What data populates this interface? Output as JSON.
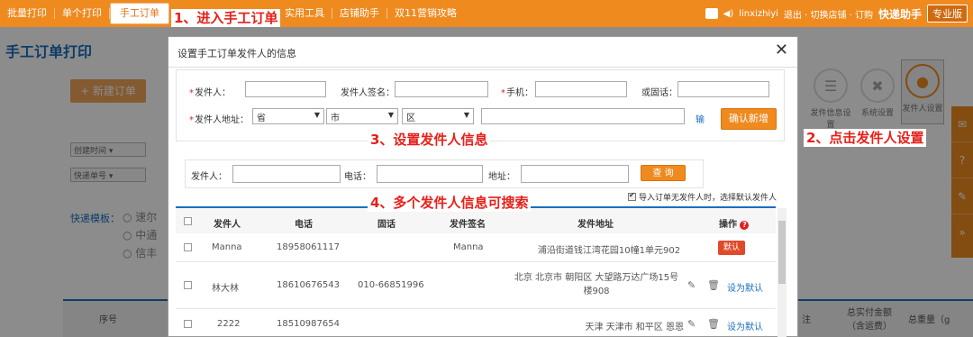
{
  "topbar": {
    "nav": [
      "批量打印",
      "单个打印",
      "手工订单",
      "实用工具",
      "店铺助手",
      "双11营销攻略"
    ],
    "active_index": 2,
    "user": "linxizhiyi",
    "links": "退出 · 切换店铺 · 订购",
    "brand": "快递助手",
    "edition": "专业版"
  },
  "page": {
    "title": "手工订单打印",
    "new_button": "+ 新建订单",
    "filter_created": "创建时间",
    "filter_express_no": "快递单号",
    "express_template_label": "快递模板：",
    "radio_options": [
      "速尔",
      "中通",
      "信丰"
    ],
    "bg_columns": [
      "序号",
      "注",
      "总实付金额（含运费）",
      "总重量（g"
    ],
    "tools": [
      "发件信息设置",
      "系统设置",
      "发件人设置"
    ]
  },
  "modal": {
    "title": "设置手工订单发件人的信息",
    "close": "✕",
    "form": {
      "sender_label": "发件人：",
      "sign_label": "发件人签名：",
      "mobile_label": "手机：",
      "phone_label": "或固话：",
      "address_label": "发件人地址：",
      "province": "省",
      "city": "市",
      "district": "区",
      "hint": "输",
      "confirm": "确认新增"
    },
    "search": {
      "sender_label": "发件人：",
      "phone_label": "电话：",
      "address_label": "地址：",
      "button": "查 询"
    },
    "default_checkbox": "导入订单无发件人时，选择默认发件人",
    "columns": [
      "发件人",
      "电话",
      "固话",
      "发件签名",
      "发件地址",
      "操作"
    ],
    "rows": [
      {
        "name": "Manna",
        "phone": "18958061117",
        "tel": "",
        "sign": "Manna",
        "address": "浦沿街道钱江湾花园10幢1单元902",
        "is_default": true,
        "action": "默认"
      },
      {
        "name": "林大林",
        "phone": "18610676543",
        "tel": "010-66851996",
        "sign": "",
        "address": "北京 北京市 朝阳区 大望路万达广场15号楼908",
        "is_default": false,
        "action": "设为默认"
      },
      {
        "name": "2222",
        "phone": "18510987654",
        "tel": "",
        "sign": "",
        "address": "天津 天津市 和平区 恩恩",
        "is_default": false,
        "action": "设为默认"
      }
    ]
  },
  "annotations": {
    "a1": "1、进入手工订单",
    "a2": "2、点击发件人设置",
    "a3": "3、设置发件人信息",
    "a4": "4、多个发件人信息可搜索"
  }
}
